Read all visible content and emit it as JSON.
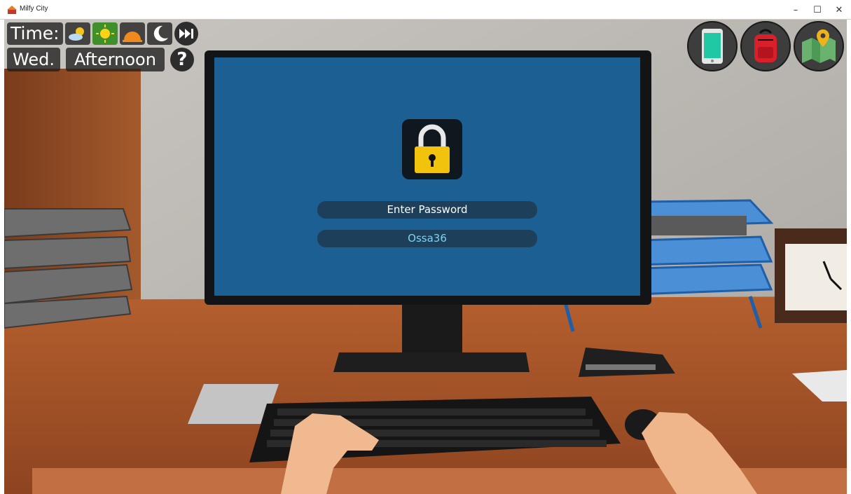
{
  "window": {
    "title": "Milfy City",
    "minimize_glyph": "–",
    "maximize_glyph": "☐",
    "close_glyph": "✕"
  },
  "hud": {
    "time_label": "Time:",
    "time_of_day_icons": [
      "morning-sun-cloud-icon",
      "day-sun-icon",
      "evening-sunset-icon",
      "night-moon-icon"
    ],
    "active_time_of_day": "day-sun-icon",
    "skip_icon": "fast-forward-icon",
    "day": "Wed.",
    "phase": "Afternoon",
    "help_label": "?",
    "quick_buttons": [
      "phone-icon",
      "backpack-icon",
      "map-icon"
    ]
  },
  "computer": {
    "lock_icon": "padlock-icon",
    "password_label": "Enter Password",
    "password_value": "Ossa36"
  },
  "colors": {
    "screen": "#1b5f93",
    "field": "#1d3f59",
    "input_text": "#7fd2f2",
    "lock_body": "#f2c30c"
  }
}
